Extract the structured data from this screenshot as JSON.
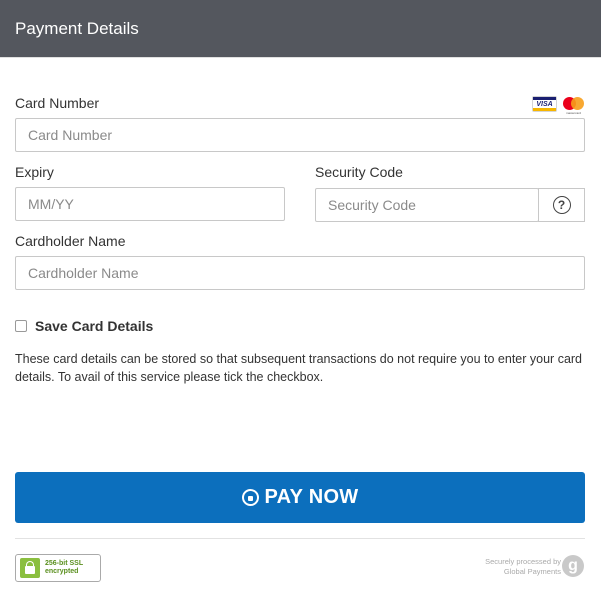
{
  "header": {
    "title": "Payment Details"
  },
  "card_number": {
    "label": "Card Number",
    "placeholder": "Card Number",
    "value": ""
  },
  "card_logos": {
    "visa_text": "VISA",
    "mastercard_text": "mastercard"
  },
  "expiry": {
    "label": "Expiry",
    "placeholder": "MM/YY",
    "value": ""
  },
  "security_code": {
    "label": "Security Code",
    "placeholder": "Security Code",
    "value": "",
    "help_symbol": "?"
  },
  "cardholder": {
    "label": "Cardholder Name",
    "placeholder": "Cardholder Name",
    "value": ""
  },
  "save_card": {
    "label": "Save Card Details",
    "checked": false,
    "description": "These card details can be stored so that subsequent transactions do not require you to enter your card details. To avail of this service please tick the checkbox."
  },
  "pay_button": {
    "label": "PAY NOW",
    "color": "#0c6fbd"
  },
  "footer": {
    "ssl_line1": "256-bit SSL",
    "ssl_line2": "encrypted",
    "secure_line1": "Securely processed by",
    "secure_line2": "Global Payments",
    "logo_letter": "g"
  },
  "colors": {
    "header_bg": "#54575e",
    "accent": "#0c6fbd",
    "ssl_green": "#8bbf3f"
  }
}
